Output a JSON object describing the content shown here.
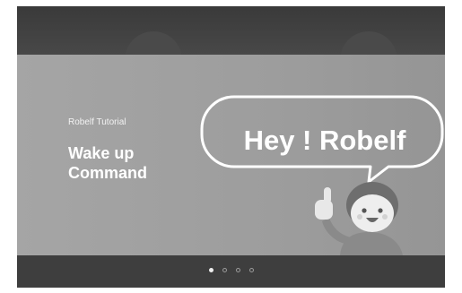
{
  "tutorial": {
    "subtitle": "Robelf Tutorial",
    "title_line1": "Wake up",
    "title_line2": "Command",
    "speech_bubble": "Hey ! Robelf"
  },
  "mascot": {
    "icon": "waving-child-icon"
  },
  "pager": {
    "page_count": 4,
    "active_page": 1
  },
  "colors": {
    "slide_background": "#a0a0a0",
    "frame_background": "#444444",
    "text": "#ffffff"
  }
}
